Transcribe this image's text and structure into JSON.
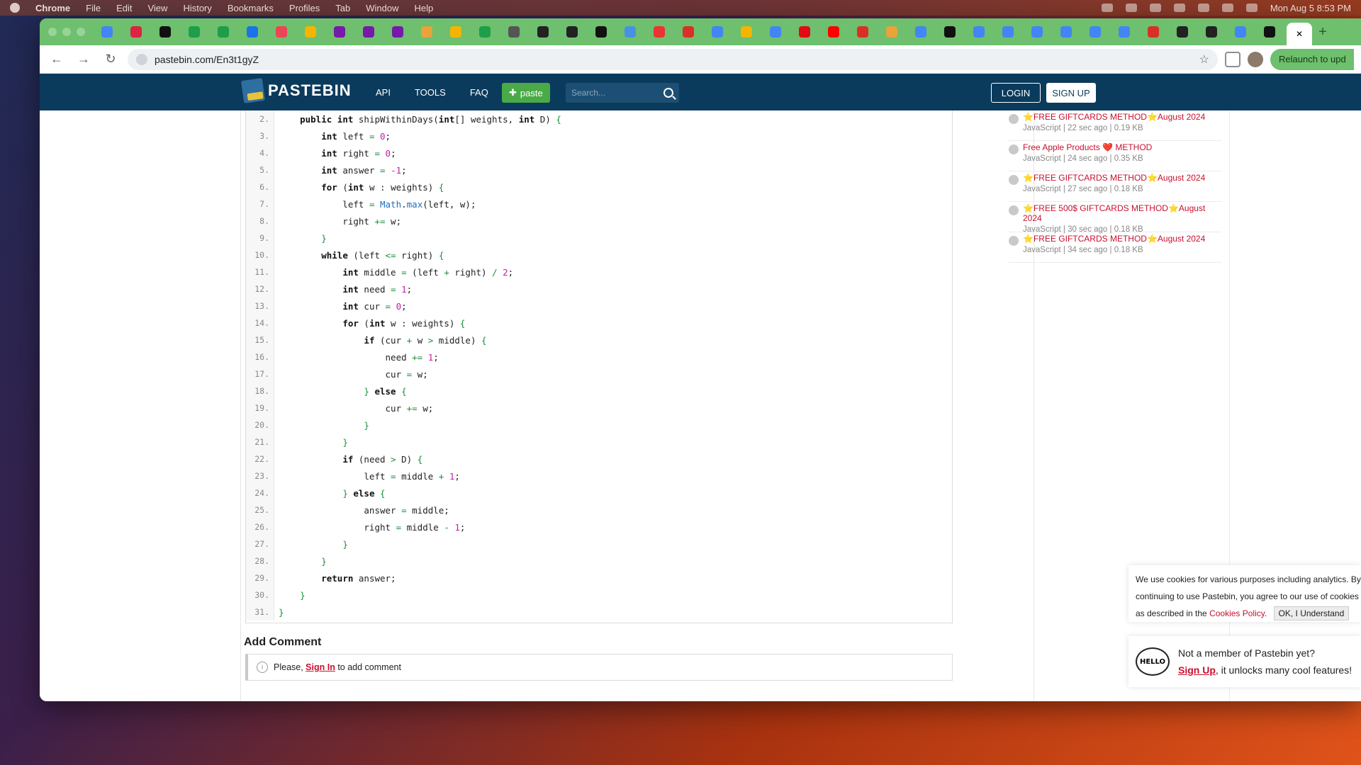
{
  "os_menubar": {
    "app": "Chrome",
    "items": [
      "File",
      "Edit",
      "View",
      "History",
      "Bookmarks",
      "Profiles",
      "Tab",
      "Window",
      "Help"
    ],
    "clock": "Mon Aug 5  8:53 PM"
  },
  "browser": {
    "url": "pastebin.com/En3t1gyZ",
    "relaunch_label": "Relaunch to upd",
    "tab_icons": [
      "google",
      "gift",
      "openai",
      "sheets",
      "sheets",
      "refresh",
      "pill",
      "drive",
      "onenote",
      "onenote",
      "onenote",
      "leetcode",
      "drive",
      "sheets",
      "rocket",
      "github",
      "github",
      "openai",
      "globe",
      "chart",
      "gmail",
      "google",
      "drive",
      "docs",
      "netflix",
      "youtube",
      "gmail",
      "leetcode",
      "calendar",
      "notion",
      "google",
      "google",
      "google",
      "google",
      "google",
      "google",
      "gmail",
      "github",
      "github",
      "docs",
      "openai"
    ],
    "accent": "#6ebf6e"
  },
  "pastebin": {
    "brand": "PASTEBIN",
    "nav": [
      "API",
      "TOOLS",
      "FAQ"
    ],
    "paste_button": "paste",
    "search_placeholder": "Search...",
    "login": "LOGIN",
    "signup": "SIGN UP"
  },
  "code": {
    "lines": [
      {
        "n": "2.",
        "html": "    <span class='kw'>public int</span> shipWithinDays(<span class='kw'>int</span>[] weights, <span class='kw'>int</span> D) <span class='op'>{</span>"
      },
      {
        "n": "3.",
        "html": "        <span class='kw'>int</span> left <span class='op'>=</span> <span class='num'>0</span>;"
      },
      {
        "n": "4.",
        "html": "        <span class='kw'>int</span> right <span class='op'>=</span> <span class='num'>0</span>;"
      },
      {
        "n": "5.",
        "html": "        <span class='kw'>int</span> answer <span class='op'>=</span> <span class='num'>-1</span>;"
      },
      {
        "n": "6.",
        "html": "        <span class='kw'>for</span> (<span class='kw'>int</span> w : weights) <span class='op'>{</span>"
      },
      {
        "n": "7.",
        "html": "            left <span class='op'>=</span> <span class='fn'>Math</span>.<span class='fn'>max</span>(left, w);"
      },
      {
        "n": "8.",
        "html": "            right <span class='op'>+=</span> w;"
      },
      {
        "n": "9.",
        "html": "        <span class='op'>}</span>"
      },
      {
        "n": "10.",
        "html": "        <span class='kw'>while</span> (left <span class='op'>&lt;=</span> right) <span class='op'>{</span>"
      },
      {
        "n": "11.",
        "html": "            <span class='kw'>int</span> middle <span class='op'>=</span> (left <span class='op'>+</span> right) <span class='op'>/</span> <span class='num'>2</span>;"
      },
      {
        "n": "12.",
        "html": "            <span class='kw'>int</span> need <span class='op'>=</span> <span class='num'>1</span>;"
      },
      {
        "n": "13.",
        "html": "            <span class='kw'>int</span> cur <span class='op'>=</span> <span class='num'>0</span>;"
      },
      {
        "n": "14.",
        "html": "            <span class='kw'>for</span> (<span class='kw'>int</span> w : weights) <span class='op'>{</span>"
      },
      {
        "n": "15.",
        "html": "                <span class='kw'>if</span> (cur <span class='op'>+</span> w <span class='op'>&gt;</span> middle) <span class='op'>{</span>"
      },
      {
        "n": "16.",
        "html": "                    need <span class='op'>+=</span> <span class='num'>1</span>;"
      },
      {
        "n": "17.",
        "html": "                    cur <span class='op'>=</span> w;"
      },
      {
        "n": "18.",
        "html": "                <span class='op'>}</span> <span class='kw'>else</span> <span class='op'>{</span>"
      },
      {
        "n": "19.",
        "html": "                    cur <span class='op'>+=</span> w;"
      },
      {
        "n": "20.",
        "html": "                <span class='op'>}</span>"
      },
      {
        "n": "21.",
        "html": "            <span class='op'>}</span>"
      },
      {
        "n": "22.",
        "html": "            <span class='kw'>if</span> (need <span class='op'>&gt;</span> D) <span class='op'>{</span>"
      },
      {
        "n": "23.",
        "html": "                left <span class='op'>=</span> middle <span class='op'>+</span> <span class='num'>1</span>;"
      },
      {
        "n": "24.",
        "html": "            <span class='op'>}</span> <span class='kw'>else</span> <span class='op'>{</span>"
      },
      {
        "n": "25.",
        "html": "                answer <span class='op'>=</span> middle;"
      },
      {
        "n": "26.",
        "html": "                right <span class='op'>=</span> middle <span class='op'>-</span> <span class='num'>1</span>;"
      },
      {
        "n": "27.",
        "html": "            <span class='op'>}</span>"
      },
      {
        "n": "28.",
        "html": "        <span class='op'>}</span>"
      },
      {
        "n": "29.",
        "html": "        <span class='kw'>return</span> answer;"
      },
      {
        "n": "30.",
        "html": "    <span class='op'>}</span>"
      },
      {
        "n": "31.",
        "html": "<span class='op'>}</span>"
      }
    ]
  },
  "comments": {
    "heading": "Add Comment",
    "prefix": "Please, ",
    "signin": "Sign In",
    "suffix": " to add comment"
  },
  "sidebar": {
    "items": [
      {
        "title": "⭐FREE GIFTCARDS METHOD⭐August 2024",
        "meta": "JavaScript | 22 sec ago | 0.19 KB"
      },
      {
        "title": "Free Apple Products ❤️ METHOD",
        "meta": "JavaScript | 24 sec ago | 0.35 KB"
      },
      {
        "title": "⭐FREE GIFTCARDS METHOD⭐August 2024",
        "meta": "JavaScript | 27 sec ago | 0.18 KB"
      },
      {
        "title": "⭐FREE 500$ GIFTCARDS METHOD⭐August 2024",
        "meta": "JavaScript | 30 sec ago | 0.18 KB"
      },
      {
        "title": "⭐FREE GIFTCARDS METHOD⭐August 2024",
        "meta": "JavaScript | 34 sec ago | 0.18 KB"
      }
    ]
  },
  "cookie": {
    "text1": "We use cookies for various purposes including analytics. By",
    "text2": "continuing to use Pastebin, you agree to our use of cookies",
    "text3": "as described in the ",
    "link": "Cookies Policy",
    "ok": "OK, I Understand"
  },
  "member": {
    "badge": "HELLO",
    "line1": "Not a member of Pastebin yet?",
    "signup": "Sign Up",
    "line2": ", it unlocks many cool features!"
  }
}
